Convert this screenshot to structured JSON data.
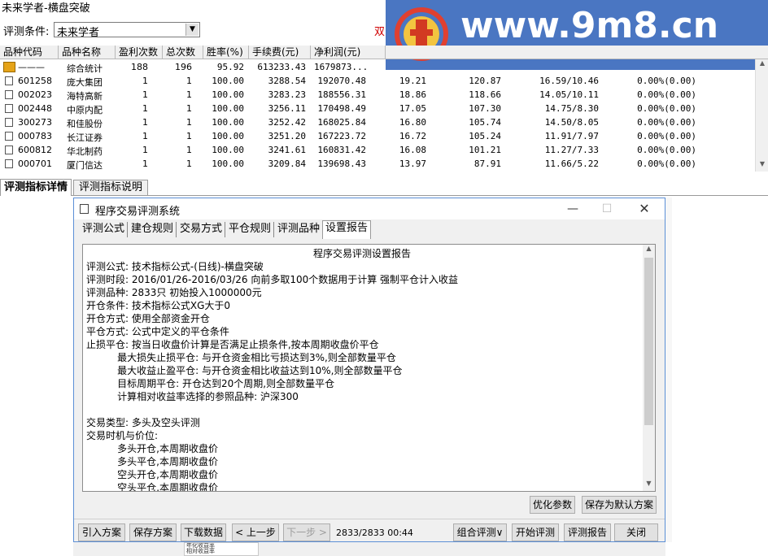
{
  "app": {
    "title": "未来学者-横盘突破",
    "condition_label": "评测条件:",
    "condition_value": "未来学者",
    "partial_text": "双"
  },
  "watermark": {
    "text": "www.9m8.cn",
    "logo_small_text": "www.9m8.cn",
    "bg_color": "#4a76c2"
  },
  "table": {
    "headers": [
      "品种代码",
      "品种名称",
      "盈利次数",
      "总次数",
      "胜率(%)",
      "手续费(元)",
      "净利润(元)"
    ],
    "summary": {
      "code": "———",
      "name": "综合统计",
      "wins": "188",
      "total": "196",
      "rate": "95.92",
      "fee": "613233.43",
      "profit": "1679873..."
    },
    "rows": [
      {
        "code": "601258",
        "name": "庞大集团",
        "wins": "1",
        "total": "1",
        "rate": "100.00",
        "fee": "3288.54",
        "profit": "192070.48",
        "c8": "19.21",
        "c9": "120.87",
        "c10": "16.59/10.46",
        "c11": "0.00%(0.00)"
      },
      {
        "code": "002023",
        "name": "海特高新",
        "wins": "1",
        "total": "1",
        "rate": "100.00",
        "fee": "3283.23",
        "profit": "188556.31",
        "c8": "18.86",
        "c9": "118.66",
        "c10": "14.05/10.11",
        "c11": "0.00%(0.00)"
      },
      {
        "code": "002448",
        "name": "中原内配",
        "wins": "1",
        "total": "1",
        "rate": "100.00",
        "fee": "3256.11",
        "profit": "170498.49",
        "c8": "17.05",
        "c9": "107.30",
        "c10": "14.75/8.30",
        "c11": "0.00%(0.00)"
      },
      {
        "code": "300273",
        "name": "和佳股份",
        "wins": "1",
        "total": "1",
        "rate": "100.00",
        "fee": "3252.42",
        "profit": "168025.84",
        "c8": "16.80",
        "c9": "105.74",
        "c10": "14.50/8.05",
        "c11": "0.00%(0.00)"
      },
      {
        "code": "000783",
        "name": "长江证券",
        "wins": "1",
        "total": "1",
        "rate": "100.00",
        "fee": "3251.20",
        "profit": "167223.72",
        "c8": "16.72",
        "c9": "105.24",
        "c10": "11.91/7.97",
        "c11": "0.00%(0.00)"
      },
      {
        "code": "600812",
        "name": "华北制药",
        "wins": "1",
        "total": "1",
        "rate": "100.00",
        "fee": "3241.61",
        "profit": "160831.42",
        "c8": "16.08",
        "c9": "101.21",
        "c10": "11.27/7.33",
        "c11": "0.00%(0.00)"
      },
      {
        "code": "000701",
        "name": "厦门信达",
        "wins": "1",
        "total": "1",
        "rate": "100.00",
        "fee": "3209.84",
        "profit": "139698.43",
        "c8": "13.97",
        "c9": "87.91",
        "c10": "11.66/5.22",
        "c11": "0.00%(0.00)"
      }
    ]
  },
  "bottom_tabs": [
    "评测指标详情",
    "评测指标说明"
  ],
  "dialog": {
    "title": "程序交易评测系统",
    "tabs": [
      "评测公式",
      "建仓规则",
      "交易方式",
      "平仓规则",
      "评测品种",
      "设置报告"
    ],
    "active_tab": "设置报告",
    "report_title": "程序交易评测设置报告",
    "report_lines": [
      "评测公式: 技术指标公式-(日线)-横盘突破",
      "评测时段: 2016/01/26-2016/03/26 向前多取100个数据用于计算 强制平仓计入收益",
      "评测品种: 2833只 初始投入1000000元",
      "开仓条件: 技术指标公式XG大于0",
      "开仓方式: 使用全部资金开仓",
      "平仓方式: 公式中定义的平仓条件",
      "止损平仓: 按当日收盘价计算是否满足止损条件,按本周期收盘价平仓",
      "          最大损失止损平仓: 与开仓资金相比亏损达到3%,则全部数量平仓",
      "          最大收益止盈平仓: 与开仓资金相比收益达到10%,则全部数量平仓",
      "          目标周期平仓: 开仓达到20个周期,则全部数量平仓",
      "          计算相对收益率选择的参照品种: 沪深300",
      "",
      "交易类型: 多头及空头评测",
      "交易时机与价位:",
      "          多头开仓,本周期收盘价",
      "          多头平仓,本周期收盘价",
      "          空头开仓,本周期收盘价",
      "          空头平仓,本周期收盘价"
    ],
    "buttons_mid": [
      "优化参数",
      "保存为默认方案"
    ],
    "buttons_bottom": [
      "引入方案",
      "保存方案",
      "下载数据",
      "< 上一步",
      "下一步 >",
      "组合评测∨",
      "开始评测",
      "评测报告",
      "关闭"
    ],
    "status": "2833/2833 00:44"
  },
  "mini_panel": {
    "lines": [
      "年化收益率",
      "相对收益率"
    ]
  }
}
